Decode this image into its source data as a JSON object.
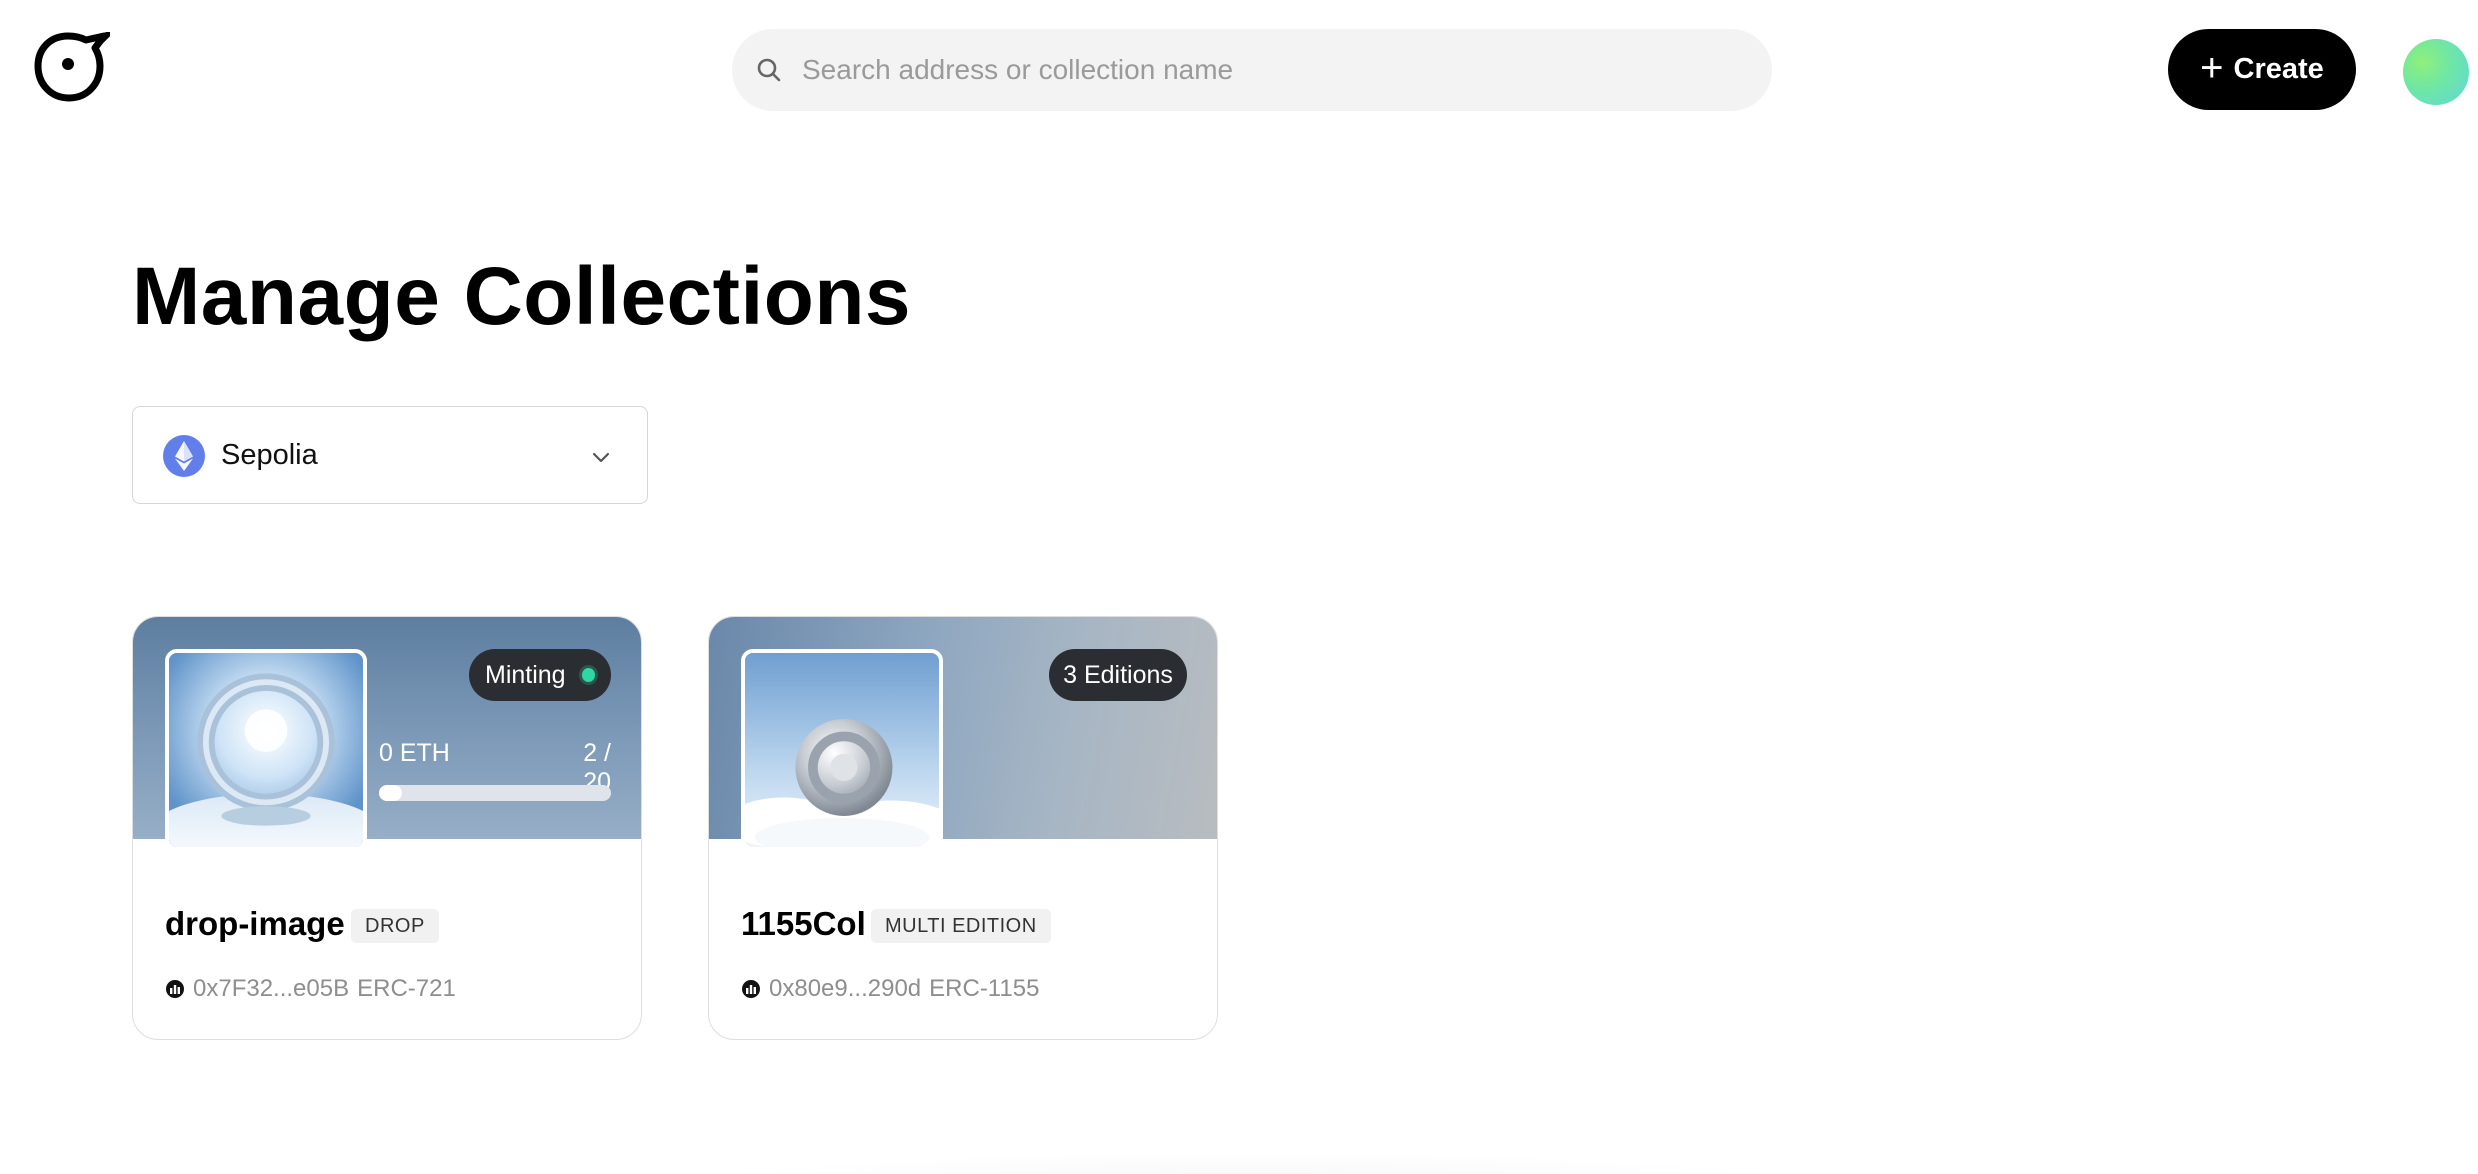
{
  "header": {
    "search_placeholder": "Search address or collection name",
    "create_label": "Create"
  },
  "page": {
    "title": "Manage Collections"
  },
  "network_select": {
    "selected": "Sepolia",
    "icon": "ethereum-icon"
  },
  "collections": [
    {
      "name": "drop-image",
      "type_tag": "DROP",
      "status": "Minting",
      "price": "0 ETH",
      "supply": "2 / 20",
      "minted_fraction": 0.1,
      "address": "0x7F32...e05B",
      "standard": "ERC-721"
    },
    {
      "name": "1155Col",
      "type_tag": "MULTI EDITION",
      "editions": "3 Editions",
      "address": "0x80e9...290d",
      "standard": "ERC-1155"
    }
  ],
  "colors": {
    "accent": "#000000",
    "minting_dot": "#2ed7a3",
    "eth_blue": "#627eea"
  }
}
